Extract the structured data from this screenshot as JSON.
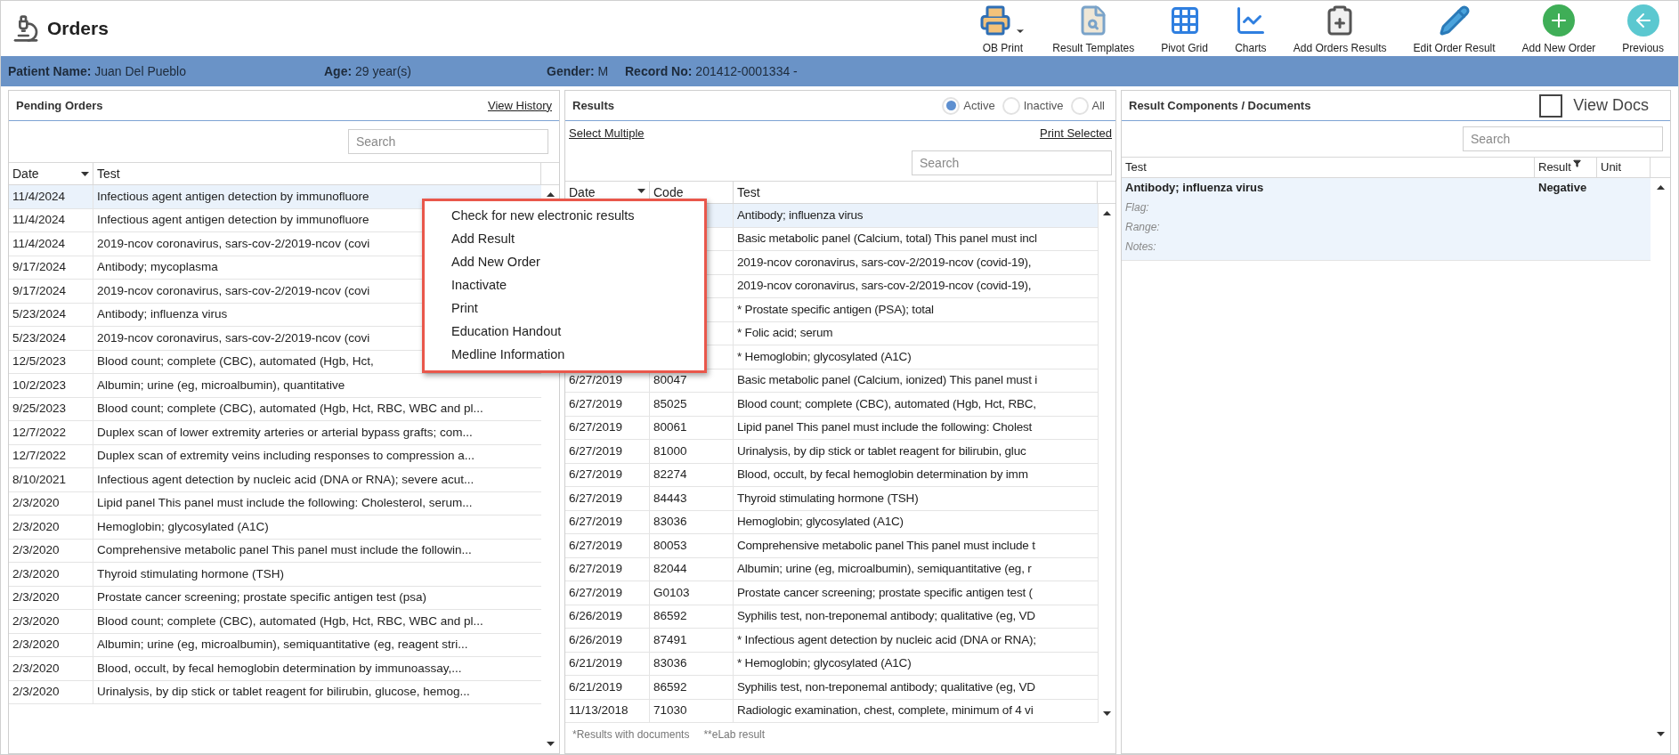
{
  "header": {
    "title": "Orders"
  },
  "toolbar": [
    {
      "kind": "printer",
      "label": "OB Print",
      "dropdown": true
    },
    {
      "kind": "template",
      "label": "Result Templates",
      "dropdown": false
    },
    {
      "kind": "grid",
      "label": "Pivot Grid",
      "dropdown": false
    },
    {
      "kind": "chart",
      "label": "Charts",
      "dropdown": false
    },
    {
      "kind": "clipboard",
      "label": "Add Orders Results",
      "dropdown": false
    },
    {
      "kind": "pencil",
      "label": "Edit Order Result",
      "dropdown": false
    },
    {
      "kind": "add",
      "label": "Add New Order",
      "dropdown": false
    },
    {
      "kind": "back",
      "label": "Previous",
      "dropdown": false
    }
  ],
  "patient": [
    {
      "label": "Patient Name:",
      "value": "Juan Del Pueblo"
    },
    {
      "label": "Age:",
      "value": "29 year(s)"
    },
    {
      "label": "Gender:",
      "value": "M"
    },
    {
      "label": "Record No:",
      "value": "201412-0001334 -"
    }
  ],
  "pending_orders": {
    "title": "Pending Orders",
    "link": "View History",
    "search": {
      "placeholder": "Search"
    },
    "columns": [
      "Date",
      "Test"
    ],
    "rows": [
      {
        "date": "11/4/2024",
        "test": "Infectious agent antigen detection by immunofluore",
        "selected": true
      },
      {
        "date": "11/4/2024",
        "test": "Infectious agent antigen detection by immunofluore",
        "selected": false
      },
      {
        "date": "11/4/2024",
        "test": "2019-ncov coronavirus, sars-cov-2/2019-ncov (covi",
        "selected": false
      },
      {
        "date": "9/17/2024",
        "test": "Antibody; mycoplasma",
        "selected": false
      },
      {
        "date": "9/17/2024",
        "test": "2019-ncov coronavirus, sars-cov-2/2019-ncov (covi",
        "selected": false
      },
      {
        "date": "5/23/2024",
        "test": "Antibody; influenza virus",
        "selected": false
      },
      {
        "date": "5/23/2024",
        "test": "2019-ncov coronavirus, sars-cov-2/2019-ncov (covi",
        "selected": false
      },
      {
        "date": "12/5/2023",
        "test": "Blood count; complete (CBC), automated (Hgb, Hct,",
        "selected": false
      },
      {
        "date": "10/2/2023",
        "test": "Albumin; urine (eg, microalbumin), quantitative",
        "selected": false
      },
      {
        "date": "9/25/2023",
        "test": "Blood count; complete (CBC), automated (Hgb, Hct, RBC, WBC and pl...",
        "selected": false
      },
      {
        "date": "12/7/2022",
        "test": "Duplex scan of lower extremity arteries or arterial bypass grafts; com...",
        "selected": false
      },
      {
        "date": "12/7/2022",
        "test": "Duplex scan of extremity veins including responses to compression a...",
        "selected": false
      },
      {
        "date": "8/10/2021",
        "test": "Infectious agent detection by nucleic acid (DNA or RNA); severe acut...",
        "selected": false
      },
      {
        "date": "2/3/2020",
        "test": "Lipid panel This panel must include the following: Cholesterol, serum...",
        "selected": false
      },
      {
        "date": "2/3/2020",
        "test": "Hemoglobin; glycosylated (A1C)",
        "selected": false
      },
      {
        "date": "2/3/2020",
        "test": "Comprehensive metabolic panel This panel must include the followin...",
        "selected": false
      },
      {
        "date": "2/3/2020",
        "test": "Thyroid stimulating hormone (TSH)",
        "selected": false
      },
      {
        "date": "2/3/2020",
        "test": "Prostate cancer screening; prostate specific antigen test (psa)",
        "selected": false
      },
      {
        "date": "2/3/2020",
        "test": "Blood count; complete (CBC), automated (Hgb, Hct, RBC, WBC and pl...",
        "selected": false
      },
      {
        "date": "2/3/2020",
        "test": "Albumin; urine (eg, microalbumin), semiquantitative (eg, reagent stri...",
        "selected": false
      },
      {
        "date": "2/3/2020",
        "test": "Blood, occult, by fecal hemoglobin determination by immunoassay,...",
        "selected": false
      },
      {
        "date": "2/3/2020",
        "test": "Urinalysis, by dip stick or tablet reagent for bilirubin, glucose, hemog...",
        "selected": false
      }
    ]
  },
  "results": {
    "title": "Results",
    "filters": [
      {
        "label": "Active",
        "selected": true
      },
      {
        "label": "Inactive",
        "selected": false
      },
      {
        "label": "All",
        "selected": false
      }
    ],
    "select_link": "Select Multiple",
    "print_link": "Print Selected",
    "search": {
      "placeholder": "Search"
    },
    "columns": [
      "Date",
      "Code",
      "Test"
    ],
    "rows": [
      {
        "test": "Antibody; influenza virus",
        "selected": true
      },
      {
        "test": "Basic metabolic panel (Calcium, total) This panel must incl",
        "selected": false
      },
      {
        "test": "2019-ncov coronavirus, sars-cov-2/2019-ncov (covid-19),",
        "selected": false
      },
      {
        "test": "2019-ncov coronavirus, sars-cov-2/2019-ncov (covid-19),",
        "selected": false
      },
      {
        "test": "* Prostate specific antigen (PSA); total",
        "selected": false
      },
      {
        "test": "* Folic acid; serum",
        "selected": false
      },
      {
        "test": "* Hemoglobin; glycosylated (A1C)",
        "selected": false
      },
      {
        "date": "6/27/2019",
        "code": "80047",
        "test": "Basic metabolic panel (Calcium, ionized) This panel must i",
        "selected": false
      },
      {
        "date": "6/27/2019",
        "code": "85025",
        "test": "Blood count; complete (CBC), automated (Hgb, Hct, RBC,",
        "selected": false
      },
      {
        "date": "6/27/2019",
        "code": "80061",
        "test": "Lipid panel This panel must include the following: Cholest",
        "selected": false
      },
      {
        "date": "6/27/2019",
        "code": "81000",
        "test": "Urinalysis, by dip stick or tablet reagent for bilirubin, gluc",
        "selected": false
      },
      {
        "date": "6/27/2019",
        "code": "82274",
        "test": "Blood, occult, by fecal hemoglobin determination by imm",
        "selected": false
      },
      {
        "date": "6/27/2019",
        "code": "84443",
        "test": "Thyroid stimulating hormone (TSH)",
        "selected": false
      },
      {
        "date": "6/27/2019",
        "code": "83036",
        "test": "Hemoglobin; glycosylated (A1C)",
        "selected": false
      },
      {
        "date": "6/27/2019",
        "code": "80053",
        "test": "Comprehensive metabolic panel This panel must include t",
        "selected": false
      },
      {
        "date": "6/27/2019",
        "code": "82044",
        "test": "Albumin; urine (eg, microalbumin), semiquantitative (eg, r",
        "selected": false
      },
      {
        "date": "6/27/2019",
        "code": "G0103",
        "test": "Prostate cancer screening; prostate specific antigen test (",
        "selected": false
      },
      {
        "date": "6/26/2019",
        "code": "86592",
        "test": "Syphilis test, non-treponemal antibody; qualitative (eg, VD",
        "selected": false
      },
      {
        "date": "6/26/2019",
        "code": "87491",
        "test": "* Infectious agent detection by nucleic acid (DNA or RNA);",
        "selected": false
      },
      {
        "date": "6/21/2019",
        "code": "83036",
        "test": "* Hemoglobin; glycosylated (A1C)",
        "selected": false
      },
      {
        "date": "6/21/2019",
        "code": "86592",
        "test": "Syphilis test, non-treponemal antibody; qualitative (eg, VD",
        "selected": false
      },
      {
        "date": "11/13/2018",
        "code": "71030",
        "test": "Radiologic examination, chest, complete, minimum of 4 vi",
        "selected": false
      }
    ],
    "footnotes": [
      "*Results with documents",
      "**eLab result"
    ]
  },
  "components": {
    "title": "Result Components / Documents",
    "view_docs": {
      "label": "View Docs",
      "checked": false
    },
    "search": {
      "placeholder": "Search"
    },
    "columns": [
      "Test",
      "Result",
      "Unit"
    ],
    "rows": [
      {
        "test": "Antibody; influenza virus",
        "result": "Negative",
        "selected": true,
        "details": [
          "Flag:",
          "Range:",
          "Notes:"
        ]
      }
    ]
  },
  "context_menu": {
    "items": [
      "Check for new electronic results",
      "Add Result",
      "Add New Order",
      "Inactivate",
      "Print",
      "Education Handout",
      "Medline Information"
    ]
  }
}
